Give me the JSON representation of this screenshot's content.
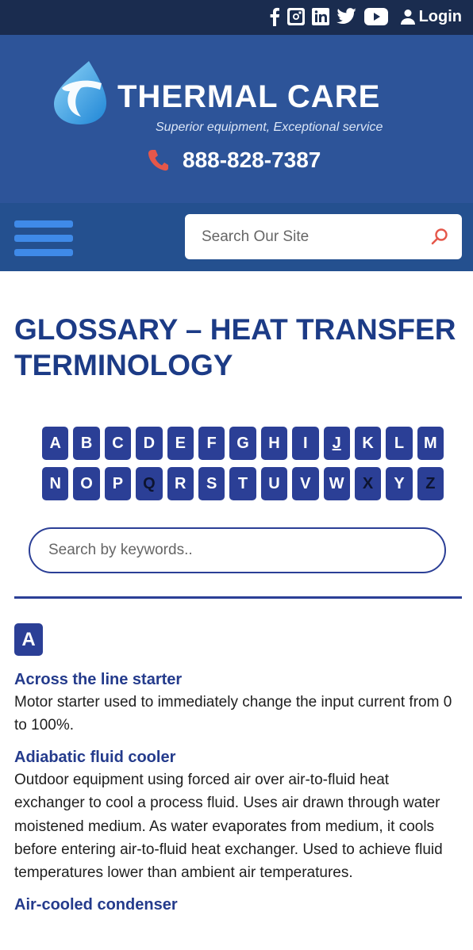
{
  "topbar": {
    "social_icons": [
      "facebook-icon",
      "instagram-icon",
      "linkedin-icon",
      "twitter-icon",
      "youtube-icon"
    ],
    "login_label": "Login"
  },
  "brand": {
    "name": "THERMAL CARE",
    "tagline": "Superior equipment, Exceptional service",
    "phone": "888-828-7387"
  },
  "nav": {
    "search_placeholder": "Search Our Site"
  },
  "page": {
    "title": "GLOSSARY – HEAT TRANSFER TERMINOLOGY"
  },
  "letters": {
    "row1": [
      "A",
      "B",
      "C",
      "D",
      "E",
      "F",
      "G",
      "H",
      "I",
      "J",
      "K",
      "L",
      "M"
    ],
    "row2": [
      "N",
      "O",
      "P",
      "Q",
      "R",
      "S",
      "T",
      "U",
      "V",
      "W",
      "X",
      "Y",
      "Z"
    ],
    "disabled": [
      "Q",
      "X",
      "Z"
    ],
    "current": "J"
  },
  "keyword_search": {
    "placeholder": "Search by keywords.."
  },
  "section": {
    "letter": "A",
    "terms": [
      {
        "title": "Across the line starter",
        "definition": "Motor starter used to immediately change the input current from 0 to 100%."
      },
      {
        "title": "Adiabatic fluid cooler",
        "definition": "Outdoor equipment using forced air over air-to-fluid heat exchanger to cool a process fluid. Uses air drawn through water moistened medium. As water evaporates from medium, it cools before entering air-to-fluid heat exchanger. Used to achieve fluid temperatures lower than ambient air temperatures."
      },
      {
        "title": "Air-cooled condenser",
        "definition": ""
      }
    ]
  },
  "colors": {
    "topbar": "#1a2c4f",
    "header": "#2d5499",
    "navbar": "#24508f",
    "accent_blue": "#2b3f96",
    "title_blue": "#1c3b86",
    "phone_icon": "#e5574a"
  }
}
